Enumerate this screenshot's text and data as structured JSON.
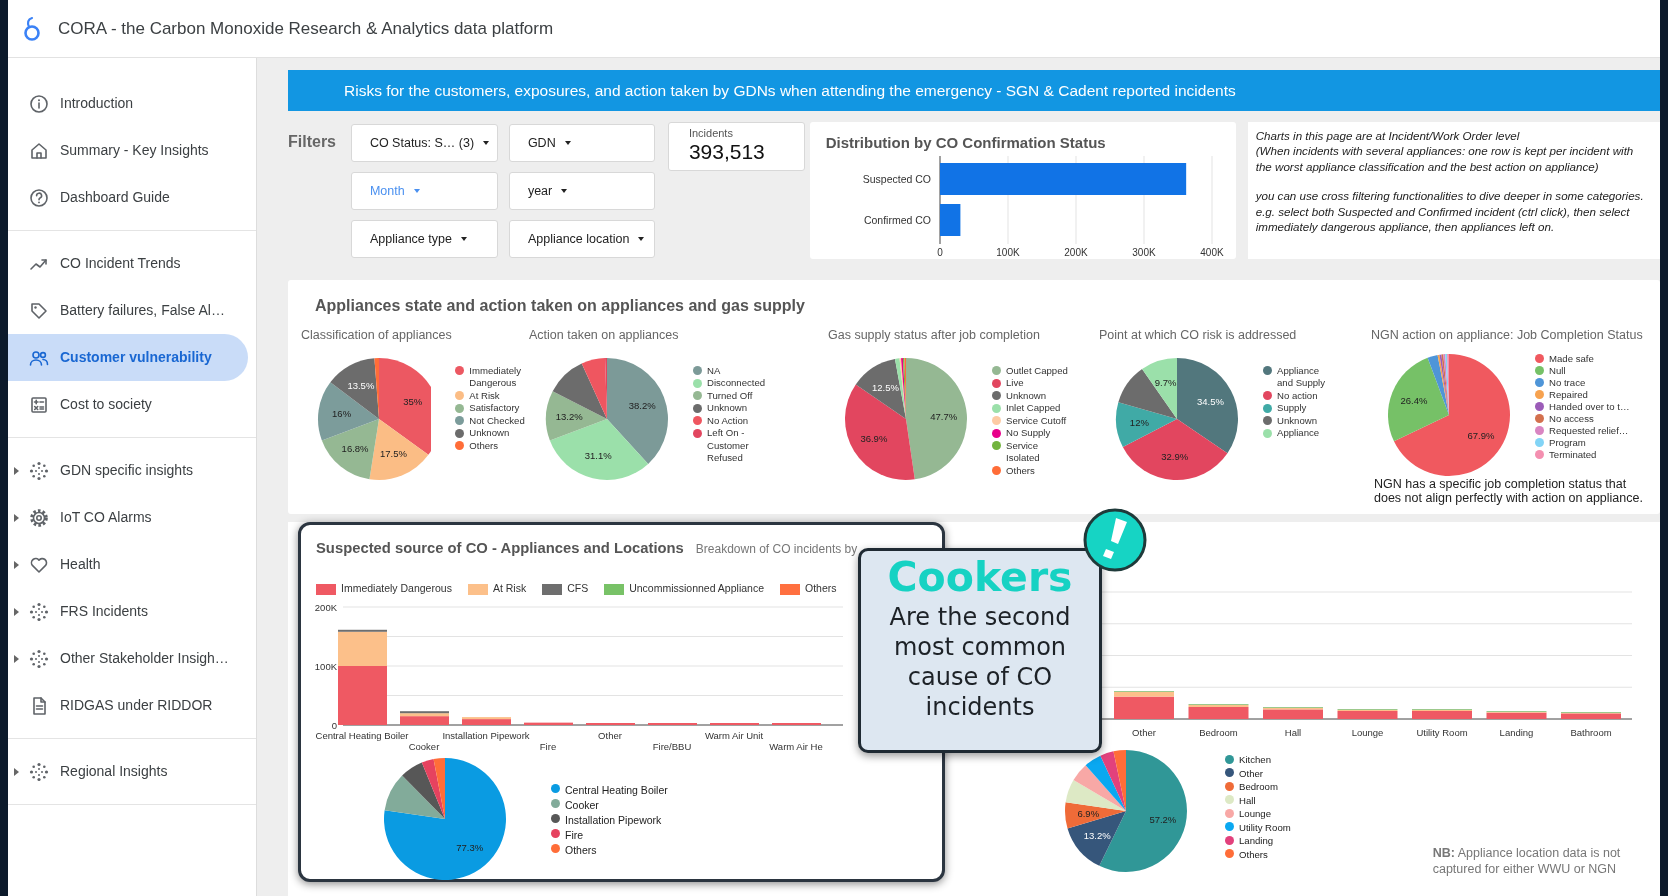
{
  "header": {
    "title": "CORA - the Carbon Monoxide Research & Analytics data platform"
  },
  "sidebar": {
    "groups": [
      {
        "items": [
          {
            "label": "Introduction",
            "selected": false,
            "expandable": false
          },
          {
            "label": "Summary - Key Insights",
            "selected": false,
            "expandable": false
          },
          {
            "label": "Dashboard Guide",
            "selected": false,
            "expandable": false
          }
        ]
      },
      {
        "items": [
          {
            "label": "CO Incident Trends",
            "selected": false,
            "expandable": false
          },
          {
            "label": "Battery failures, False Al…",
            "selected": false,
            "expandable": false
          },
          {
            "label": "Customer vulnerability",
            "selected": true,
            "expandable": false
          },
          {
            "label": "Cost to society",
            "selected": false,
            "expandable": false
          }
        ]
      },
      {
        "items": [
          {
            "label": "GDN specific insights",
            "selected": false,
            "expandable": true
          },
          {
            "label": "IoT CO Alarms",
            "selected": false,
            "expandable": true
          },
          {
            "label": "Health",
            "selected": false,
            "expandable": true
          },
          {
            "label": "FRS Incidents",
            "selected": false,
            "expandable": true
          },
          {
            "label": "Other Stakeholder Insigh…",
            "selected": false,
            "expandable": true
          },
          {
            "label": "RIDGAS under RIDDOR",
            "selected": false,
            "expandable": false
          }
        ]
      },
      {
        "items": [
          {
            "label": "Regional Insights",
            "selected": false,
            "expandable": true
          }
        ]
      }
    ]
  },
  "banner": "Risks for the customers, exposures, and action taken by GDNs when attending the emergency - SGN & Cadent reported incidents",
  "filters": {
    "label": "Filters",
    "dropdowns": [
      {
        "label": "CO Status: S… (3)",
        "active": false
      },
      {
        "label": "GDN",
        "active": false
      },
      {
        "label": "Month",
        "active": true
      },
      {
        "label": "year",
        "active": false
      },
      {
        "label": "Appliance type",
        "active": false
      },
      {
        "label": "Appliance location",
        "active": false
      }
    ]
  },
  "scorecard": {
    "label": "Incidents",
    "value": "393,513"
  },
  "confirmation_chart": {
    "title": "Distribution by CO Confirmation Status",
    "chart_data": {
      "type": "bar",
      "orientation": "horizontal",
      "grid": true,
      "categories": [
        "Suspected CO",
        "Confirmed CO"
      ],
      "values": [
        362000,
        30000
      ],
      "xlim": [
        0,
        400000
      ],
      "xticks": [
        {
          "value": 0,
          "label": "0"
        },
        {
          "value": 100000,
          "label": "100K"
        },
        {
          "value": 200000,
          "label": "200K"
        },
        {
          "value": 300000,
          "label": "300K"
        },
        {
          "value": 400000,
          "label": "400K"
        }
      ]
    }
  },
  "note": {
    "paragraphs": [
      "Charts in this page are at Incident/Work Order level",
      "(When incidents with several appliances: one row is kept per incident with the worst appliance classification and the best action on appliance)",
      "you can use cross filtering functionalities to dive deeper in some categories.",
      "e.g. select both Suspected and Confirmed incident (ctrl click), then select immediately dangerous appliance, then appliances left on."
    ]
  },
  "appliances_section": {
    "title": "Appliances state and action taken on appliances and gas supply",
    "pies": [
      {
        "title": "Classification of appliances",
        "chart_data": {
          "type": "pie",
          "categories": [
            "Immediately Dangerous",
            "At Risk",
            "Satisfactory",
            "Not Checked",
            "Unknown",
            "Others"
          ],
          "colors": [
            "#ec5862",
            "#fbbd85",
            "#95b893",
            "#7c9c9b",
            "#6c6c6c",
            "#ff6d38"
          ],
          "values": [
            35,
            17.5,
            16.8,
            16,
            13.5,
            1.2
          ],
          "value_labels": [
            "35%",
            "17.5%",
            "16.8%",
            "16%",
            "13.5%",
            null
          ]
        }
      },
      {
        "title": "Action taken on appliances",
        "chart_data": {
          "type": "pie",
          "categories": [
            "NA",
            "Disconnected",
            "Turned Off",
            "Unknown",
            "No Action",
            "Left On - Customer Refused"
          ],
          "colors": [
            "#7c9a98",
            "#9be0aa",
            "#95b893",
            "#6c6c6c",
            "#ef5660",
            "#e2465f"
          ],
          "values": [
            38.2,
            31.1,
            13.2,
            10.7,
            6.3,
            0.5
          ],
          "value_labels": [
            "38.2%",
            "31.1%",
            "13.2%",
            null,
            null,
            null
          ]
        }
      },
      {
        "title": "Gas supply status after job completion",
        "chart_data": {
          "type": "pie",
          "categories": [
            "Outlet Capped",
            "Live",
            "Unknown",
            "Inlet Capped",
            "Service Cutoff",
            "No Supply",
            "Service Isolated",
            "Others"
          ],
          "colors": [
            "#95b893",
            "#e2465f",
            "#6c6c6c",
            "#9be0aa",
            "#fdcba4",
            "#e8008a",
            "#72b43e",
            "#ff6d38"
          ],
          "values": [
            47.7,
            36.9,
            12.5,
            1.2,
            0.4,
            0.5,
            0.4,
            0.4
          ],
          "value_labels": [
            "47.7%",
            "36.9%",
            "12.5%",
            null,
            null,
            null,
            null,
            null
          ]
        }
      },
      {
        "title": "Point at which CO risk is addressed",
        "chart_data": {
          "type": "pie",
          "categories": [
            "Appliance and Supply",
            "No action",
            "Supply",
            "Unknown",
            "Appliance"
          ],
          "colors": [
            "#52777d",
            "#e2465f",
            "#40aaa6",
            "#6c6c6c",
            "#9be0aa"
          ],
          "values": [
            34.5,
            32.9,
            12,
            10.9,
            9.7
          ],
          "value_labels": [
            "34.5%",
            "32.9%",
            "12%",
            null,
            "9.7%"
          ]
        }
      },
      {
        "title": "NGN action on appliance: Job Completion Status",
        "chart_data": {
          "type": "pie",
          "categories": [
            "Made safe",
            "Null",
            "No trace",
            "Repaired",
            "Handed over to t…",
            "No access",
            "Requested relief…",
            "Program",
            "Terminated"
          ],
          "colors": [
            "#f0595f",
            "#76c167",
            "#4e95d8",
            "#f7a24f",
            "#9b5cb8",
            "#d3704e",
            "#d985c2",
            "#82d4f6",
            "#f48fb0"
          ],
          "values": [
            67.9,
            26.4,
            2.7,
            0.5,
            0.5,
            0.5,
            0.5,
            0.5,
            0.5
          ],
          "value_labels": [
            "67.9%",
            "26.4%",
            null,
            null,
            null,
            null,
            null,
            null,
            null
          ]
        }
      }
    ],
    "ngn_note": "NGN has a specific job completion status that does not align perfectly with action on appliance."
  },
  "source_section": {
    "title": "Suspected source of CO - Appliances and Locations",
    "subtitle": "Breakdown of CO incidents by",
    "appliance_chart": {
      "chart_data": {
        "type": "bar",
        "stacked": true,
        "categories": [
          "Central Heating Boiler",
          "Cooker",
          "Installation Pipework",
          "Fire",
          "Other",
          "Fire/BBU",
          "Warm Air Unit",
          "Warm Air He"
        ],
        "series": [
          {
            "name": "Immediately Dangerous",
            "color": "#ef5963",
            "values": [
              100000,
              15000,
              10000,
              4000,
              3000,
              2000,
              2000,
              2000
            ]
          },
          {
            "name": "At Risk",
            "color": "#fcc08a",
            "values": [
              58000,
              5000,
              3000,
              0,
              0,
              0,
              0,
              0
            ]
          },
          {
            "name": "CFS",
            "color": "#6e6e6e",
            "values": [
              3000,
              3000,
              0,
              0,
              0,
              0,
              0,
              0
            ]
          },
          {
            "name": "Uncommissionned Appliance",
            "color": "#78c267",
            "values": [
              0,
              0,
              0,
              0,
              0,
              0,
              0,
              0
            ]
          },
          {
            "name": "Others",
            "color": "#ff7040",
            "values": [
              0,
              0,
              0,
              0,
              0,
              0,
              0,
              0
            ]
          }
        ],
        "ylim": [
          0,
          200000
        ],
        "yticks": [
          {
            "value": 0,
            "label": "0"
          },
          {
            "value": 100000,
            "label": "100K"
          },
          {
            "value": 200000,
            "label": "200K"
          }
        ]
      }
    },
    "appliance_pie": {
      "chart_data": {
        "type": "pie",
        "categories": [
          "Central Heating Boiler",
          "Cooker",
          "Installation Pipework",
          "Fire",
          "Others"
        ],
        "colors": [
          "#0a9be2",
          "#82ab9a",
          "#575757",
          "#e6425f",
          "#ff6d38"
        ],
        "values": [
          77.3,
          10.3,
          6.2,
          3.2,
          3.0
        ],
        "value_labels": [
          "77.3%",
          null,
          null,
          null,
          null
        ]
      }
    },
    "location_chart": {
      "categories": [
        "Other",
        "Bedroom",
        "Hall",
        "Lounge",
        "Utility Room",
        "Landing",
        "Bathroom"
      ]
    },
    "location_pie": {
      "chart_data": {
        "type": "pie",
        "categories": [
          "Kitchen",
          "Other",
          "Bedroom",
          "Hall",
          "Lounge",
          "Utility Room",
          "Landing",
          "Others"
        ],
        "colors": [
          "#309797",
          "#36567b",
          "#ef6b38",
          "#dde9c5",
          "#f8a8a6",
          "#0aa8f1",
          "#e2417c",
          "#ff6d38"
        ],
        "values": [
          57.2,
          13.2,
          6.9,
          6.2,
          5.0,
          4.6,
          3.6,
          3.3
        ],
        "value_labels": [
          "57.2%",
          "13.2%",
          "6.9%",
          null,
          null,
          null,
          null,
          null
        ]
      }
    },
    "nb_note": "**NB:** Appliance location data is not captured for either WWU or NGN"
  },
  "callout": {
    "headline": "Cookers",
    "text": "Are the second most common cause of CO incidents"
  }
}
